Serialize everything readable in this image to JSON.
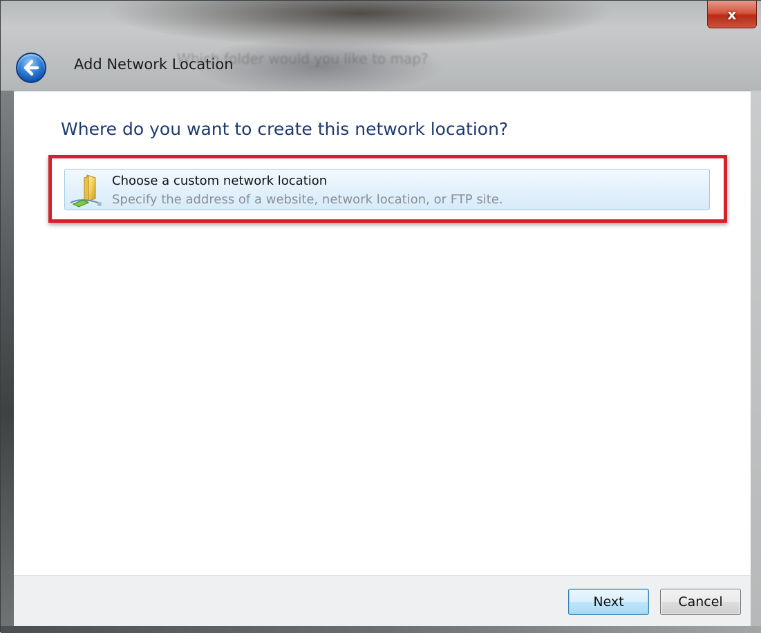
{
  "window": {
    "title": "Add Network Location",
    "background_text": "Which folder would you like to map?",
    "close_label": "x"
  },
  "main": {
    "heading": "Where do you want to create this network location?",
    "option": {
      "title": "Choose a custom network location",
      "description": "Specify the address of a website, network location, or FTP site.",
      "icon": "network-folder-icon",
      "highlight_color": "#d6212a"
    }
  },
  "footer": {
    "next_label": "Next",
    "cancel_label": "Cancel"
  },
  "colors": {
    "heading": "#1e3a6e",
    "option_description": "#8a8f94"
  }
}
